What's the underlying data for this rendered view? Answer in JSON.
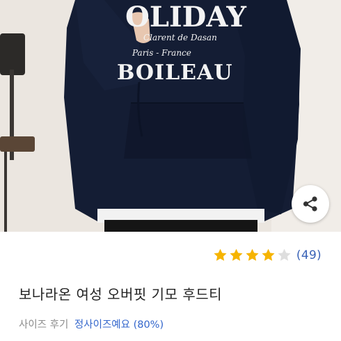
{
  "product": {
    "image": {
      "print_line1": "OLIDAY",
      "print_line2": "Clarent de Dasan",
      "print_line3": "Paris - France",
      "print_line4": "BOILEAU"
    },
    "share": {
      "icon": "share-icon"
    },
    "rating": {
      "stars": 4,
      "max_stars": 5,
      "review_count": "(49)",
      "star_color": "#f6b400",
      "empty_star_color": "#dedede"
    },
    "title": "보나라온 여성 오버핏 기모 후드티",
    "size_review": {
      "label": "사이즈 후기",
      "value": "정사이즈예요 (80%)"
    }
  },
  "colors": {
    "link": "#3a63b7",
    "hoodie": "#131c33"
  }
}
